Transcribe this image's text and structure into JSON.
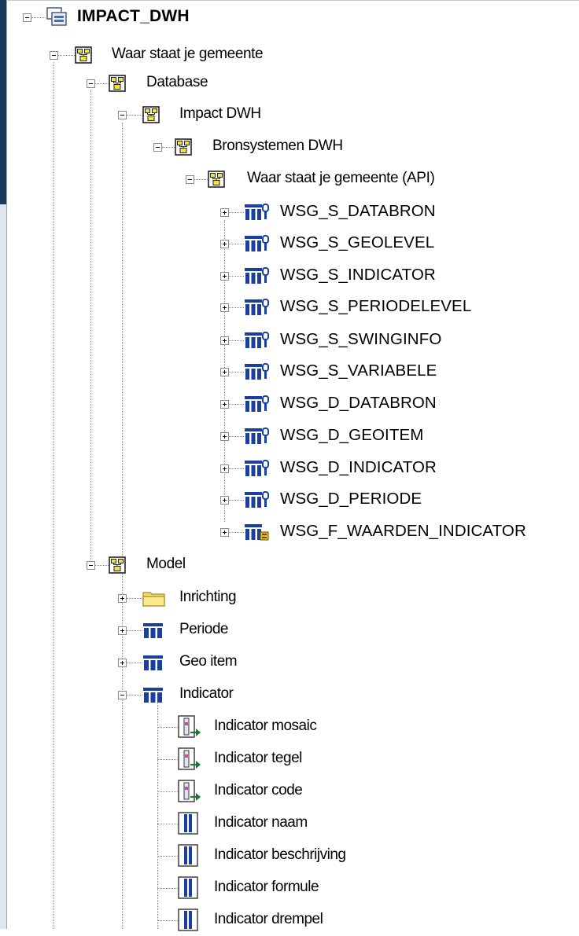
{
  "tree": {
    "root": {
      "label": "IMPACT_DWH",
      "icon": "database-model-icon",
      "state": "expanded"
    },
    "nodes": [
      {
        "label": "Waar staat je gemeente",
        "icon": "package-icon",
        "state": "expanded"
      },
      {
        "label": "Database",
        "icon": "package-icon",
        "state": "expanded"
      },
      {
        "label": "Impact DWH",
        "icon": "package-icon",
        "state": "expanded"
      },
      {
        "label": "Bronsystemen DWH",
        "icon": "package-icon",
        "state": "expanded"
      },
      {
        "label": "Waar staat je gemeente (API)",
        "icon": "package-icon",
        "state": "expanded"
      },
      {
        "label": "WSG_S_DATABRON",
        "icon": "table-key-icon",
        "state": "collapsed"
      },
      {
        "label": "WSG_S_GEOLEVEL",
        "icon": "table-key-icon",
        "state": "collapsed"
      },
      {
        "label": "WSG_S_INDICATOR",
        "icon": "table-key-icon",
        "state": "collapsed"
      },
      {
        "label": "WSG_S_PERIODELEVEL",
        "icon": "table-key-icon",
        "state": "collapsed"
      },
      {
        "label": "WSG_S_SWINGINFO",
        "icon": "table-key-icon",
        "state": "collapsed"
      },
      {
        "label": "WSG_S_VARIABELE",
        "icon": "table-key-icon",
        "state": "collapsed"
      },
      {
        "label": "WSG_D_DATABRON",
        "icon": "table-key-icon",
        "state": "collapsed"
      },
      {
        "label": "WSG_D_GEOITEM",
        "icon": "table-key-icon",
        "state": "collapsed"
      },
      {
        "label": "WSG_D_INDICATOR",
        "icon": "table-key-icon",
        "state": "collapsed"
      },
      {
        "label": "WSG_D_PERIODE",
        "icon": "table-key-icon",
        "state": "collapsed"
      },
      {
        "label": "WSG_F_WAARDEN_INDICATOR",
        "icon": "fact-table-icon",
        "state": "collapsed"
      },
      {
        "label": "Model",
        "icon": "package-icon",
        "state": "expanded"
      },
      {
        "label": "Inrichting",
        "icon": "folder-icon",
        "state": "collapsed"
      },
      {
        "label": "Periode",
        "icon": "dimension-icon",
        "state": "collapsed"
      },
      {
        "label": "Geo item",
        "icon": "dimension-icon",
        "state": "collapsed"
      },
      {
        "label": "Indicator",
        "icon": "dimension-icon",
        "state": "expanded"
      },
      {
        "label": "Indicator mosaic",
        "icon": "key-attribute-icon",
        "state": "leaf"
      },
      {
        "label": "Indicator tegel",
        "icon": "key-attribute-icon",
        "state": "leaf"
      },
      {
        "label": "Indicator code",
        "icon": "key-attribute-icon",
        "state": "leaf"
      },
      {
        "label": "Indicator naam",
        "icon": "attribute-icon",
        "state": "leaf"
      },
      {
        "label": "Indicator beschrijving",
        "icon": "attribute-icon",
        "state": "leaf"
      },
      {
        "label": "Indicator formule",
        "icon": "attribute-icon",
        "state": "leaf"
      },
      {
        "label": "Indicator drempel",
        "icon": "attribute-icon",
        "state": "leaf"
      }
    ]
  },
  "colors": {
    "tree_line": "#8a8a8a",
    "package_yellow": "#f2e23a",
    "table_blue": "#1a3f9e",
    "folder_yellow": "#f7dc6f"
  }
}
